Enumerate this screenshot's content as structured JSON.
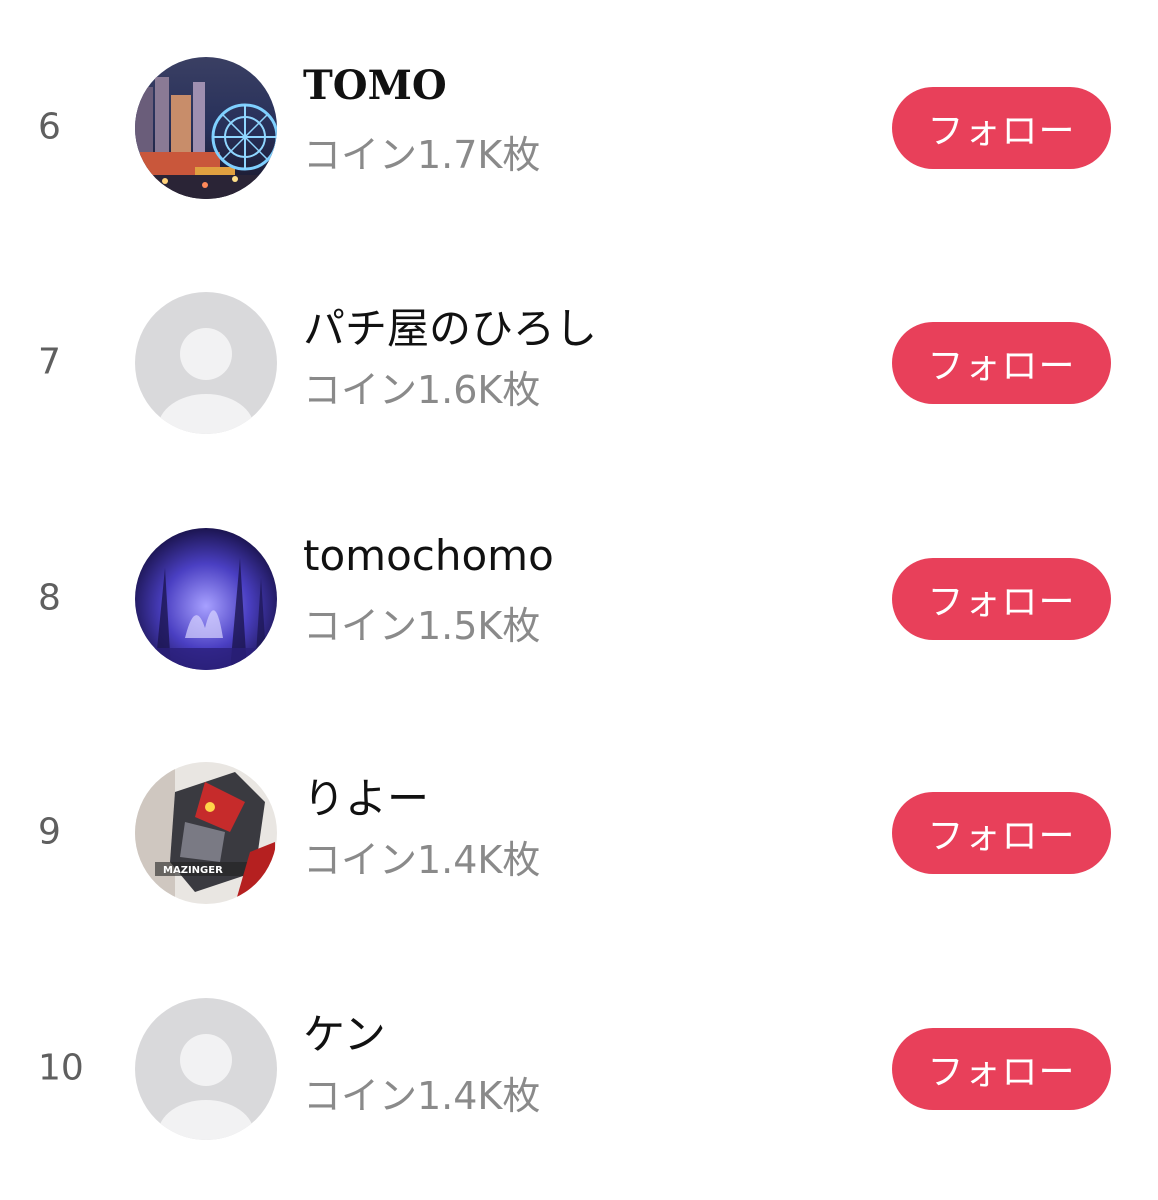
{
  "ranking": [
    {
      "rank": "6",
      "name": "TOMO",
      "coins": "コイン1.7K枚",
      "follow_label": "フォロー",
      "avatar": "night-city-ferris-wheel-photo"
    },
    {
      "rank": "7",
      "name": "パチ屋のひろし",
      "coins": "コイン1.6K枚",
      "follow_label": "フォロー",
      "avatar": "default-avatar"
    },
    {
      "rank": "8",
      "name": "tomochomo",
      "coins": "コイン1.5K枚",
      "follow_label": "フォロー",
      "avatar": "blue-lit-trees-photo"
    },
    {
      "rank": "9",
      "name": "りよー",
      "coins": "コイン1.4K枚",
      "follow_label": "フォロー",
      "avatar": "mazinger-poster-image"
    },
    {
      "rank": "10",
      "name": "ケン",
      "coins": "コイン1.4K枚",
      "follow_label": "フォロー",
      "avatar": "default-avatar"
    }
  ],
  "colors": {
    "follow_button": "#e8405a",
    "rank_text": "#5f5f5f",
    "coins_text": "#8a8a8a",
    "default_avatar_bg": "#d9d9db"
  }
}
